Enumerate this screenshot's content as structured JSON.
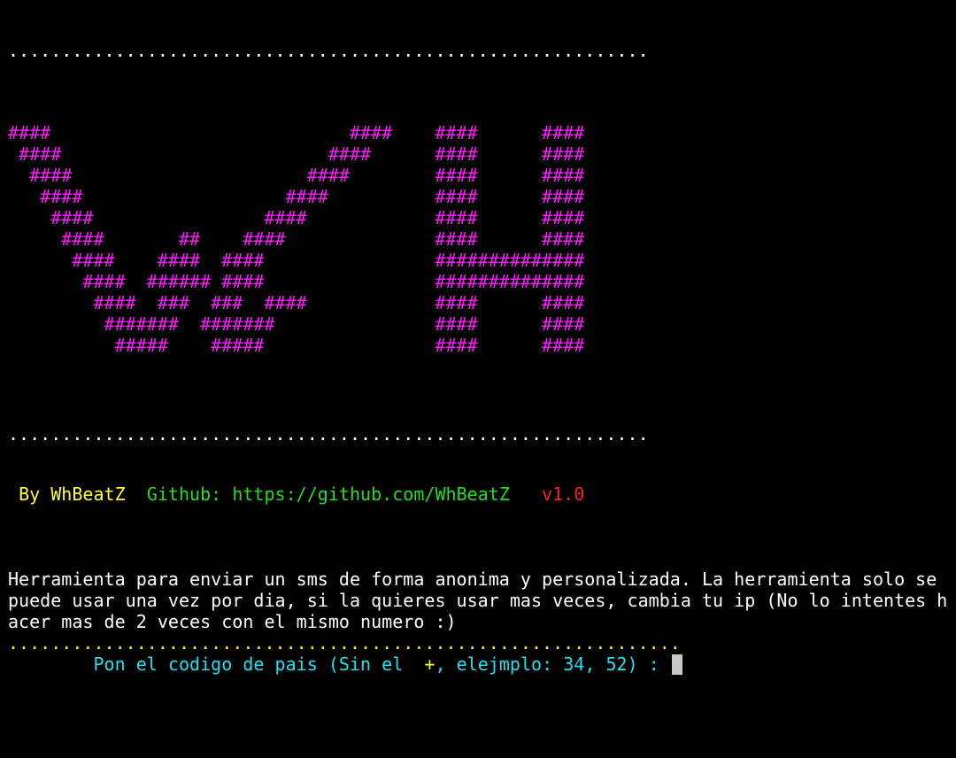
{
  "separators": {
    "top": "............................................................",
    "middle": "............................................................",
    "prompt": "..............................................................."
  },
  "banner_art": [
    "####                            ####    ####      ####",
    " ####                         ####      ####      ####",
    "  ####                      ####        ####      ####",
    "   ####                   ####          ####      ####",
    "    ####                ####            ####      ####",
    "     ####       ##    ####              ####      ####",
    "      ####    ####  ####                ##############",
    "       ####  ###### ####                ##############",
    "        ####  ###  ###  ####            ####      ####",
    "         #######  #######               ####      ####",
    "          #####    #####                ####      ####"
  ],
  "credits": {
    "author": "By WhBeatZ",
    "github_label": "Github:",
    "github_url": "https://github.com/WhBeatZ",
    "version": "v1.0"
  },
  "description": [
    "Herramienta para enviar un sms de forma anonima y personalizada. La herramienta solo se",
    "puede usar una vez por dia, si la quieres usar mas veces, cambia tu ip (No lo intentes h",
    "acer mas de 2 veces con el mismo numero :)"
  ],
  "prompt": {
    "indent": "        ",
    "before_plus": "Pon el codigo de pais (Sin el  ",
    "plus": "+",
    "after_plus": ", elejmplo: 34, 52) : "
  },
  "colors": {
    "art": "#ff1aff",
    "author": "#ffff33",
    "github": "#22dd22",
    "version": "#ff1f1f",
    "prompt": "#22e0ee",
    "prompt_separator": "#ffee00"
  }
}
